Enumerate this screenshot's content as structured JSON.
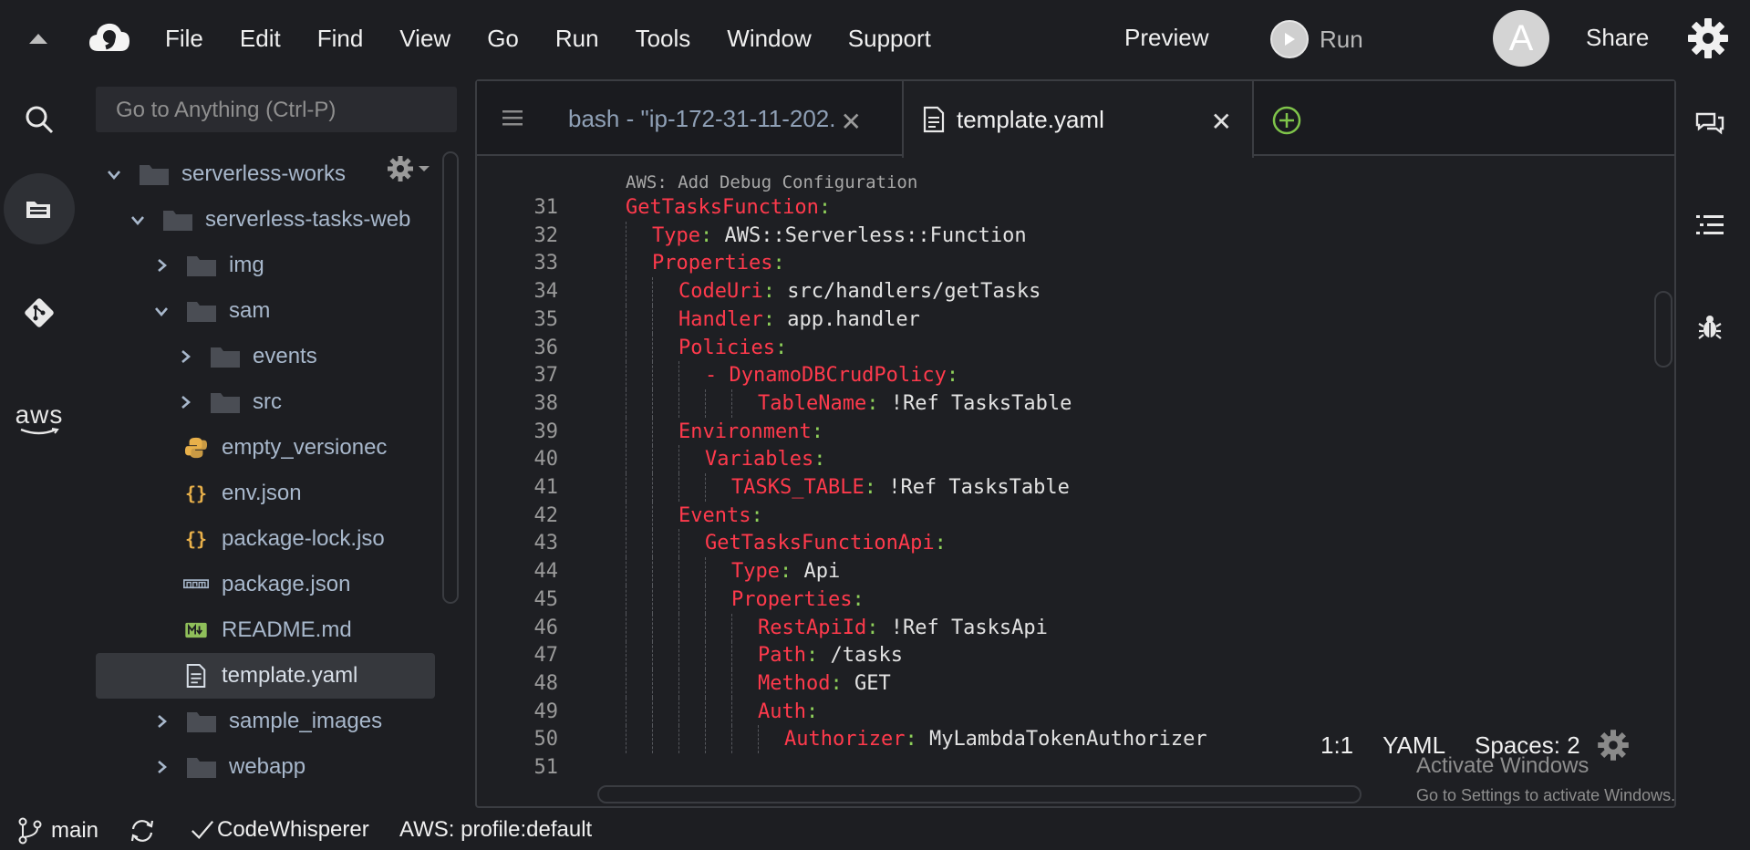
{
  "menubar": {
    "items": [
      "File",
      "Edit",
      "Find",
      "View",
      "Go",
      "Run",
      "Tools",
      "Window",
      "Support"
    ],
    "preview_label": "Preview",
    "run_label": "Run",
    "avatar_letter": "A",
    "share_label": "Share"
  },
  "sidebar": {
    "goto_placeholder": "Go to Anything (Ctrl-P)",
    "rail_aws_label": "aws",
    "tree": [
      {
        "label": "serverless-works",
        "type": "folder",
        "expanded": true
      },
      {
        "label": "serverless-tasks-web",
        "type": "folder",
        "expanded": true
      },
      {
        "label": "img",
        "type": "folder",
        "expanded": false
      },
      {
        "label": "sam",
        "type": "folder",
        "expanded": true
      },
      {
        "label": "events",
        "type": "folder",
        "expanded": false
      },
      {
        "label": "src",
        "type": "folder",
        "expanded": false
      },
      {
        "label": "empty_versionec",
        "type": "python-file"
      },
      {
        "label": "env.json",
        "type": "json-file"
      },
      {
        "label": "package-lock.jso",
        "type": "json-file"
      },
      {
        "label": "package.json",
        "type": "npm-file"
      },
      {
        "label": "README.md",
        "type": "markdown-file"
      },
      {
        "label": "template.yaml",
        "type": "text-file",
        "selected": true
      },
      {
        "label": "sample_images",
        "type": "folder",
        "expanded": false
      },
      {
        "label": "webapp",
        "type": "folder",
        "expanded": false
      }
    ]
  },
  "editor": {
    "tabs": [
      {
        "label": "bash - \"ip-172-31-11-202.",
        "active": false
      },
      {
        "label": "template.yaml",
        "active": true
      }
    ],
    "codelens": "AWS: Add Debug Configuration",
    "lines": [
      {
        "n": "31",
        "indent": 0,
        "key": "GetTasksFunction",
        "value": ""
      },
      {
        "n": "32",
        "indent": 1,
        "key": "Type",
        "value": " AWS::Serverless::Function"
      },
      {
        "n": "33",
        "indent": 1,
        "key": "Properties",
        "value": ""
      },
      {
        "n": "34",
        "indent": 2,
        "key": "CodeUri",
        "value": " src/handlers/getTasks"
      },
      {
        "n": "35",
        "indent": 2,
        "key": "Handler",
        "value": " app.handler"
      },
      {
        "n": "36",
        "indent": 2,
        "key": "Policies",
        "value": ""
      },
      {
        "n": "37",
        "indent": 3,
        "key": "- DynamoDBCrudPolicy",
        "value": ""
      },
      {
        "n": "38",
        "indent": 5,
        "key": "TableName",
        "value": " !Ref TasksTable"
      },
      {
        "n": "39",
        "indent": 2,
        "key": "Environment",
        "value": ""
      },
      {
        "n": "40",
        "indent": 3,
        "key": "Variables",
        "value": ""
      },
      {
        "n": "41",
        "indent": 4,
        "key": "TASKS_TABLE",
        "value": " !Ref TasksTable"
      },
      {
        "n": "42",
        "indent": 2,
        "key": "Events",
        "value": ""
      },
      {
        "n": "43",
        "indent": 3,
        "key": "GetTasksFunctionApi",
        "value": ""
      },
      {
        "n": "44",
        "indent": 4,
        "key": "Type",
        "value": " Api"
      },
      {
        "n": "45",
        "indent": 4,
        "key": "Properties",
        "value": ""
      },
      {
        "n": "46",
        "indent": 5,
        "key": "RestApiId",
        "value": " !Ref TasksApi"
      },
      {
        "n": "47",
        "indent": 5,
        "key": "Path",
        "value": " /tasks"
      },
      {
        "n": "48",
        "indent": 5,
        "key": "Method",
        "value": " GET"
      },
      {
        "n": "49",
        "indent": 5,
        "key": "Auth",
        "value": ""
      },
      {
        "n": "50",
        "indent": 6,
        "key": "Authorizer",
        "value": " MyLambdaTokenAuthorizer"
      },
      {
        "n": "51",
        "indent": 0,
        "key": "",
        "value": ""
      }
    ],
    "status": {
      "cursor": "1:1",
      "language": "YAML",
      "spaces": "Spaces: 2"
    }
  },
  "watermark": {
    "title": "Activate Windows",
    "subtitle": "Go to Settings to activate Windows."
  },
  "statusbar": {
    "branch": "main",
    "codewhisperer": "CodeWhisperer",
    "aws_profile": "AWS: profile:default"
  },
  "colors": {
    "background": "#1d1e22",
    "yaml_key": "#ff3a4c",
    "yaml_colon": "#8fd05a",
    "tree_text": "#a8b8cc"
  }
}
